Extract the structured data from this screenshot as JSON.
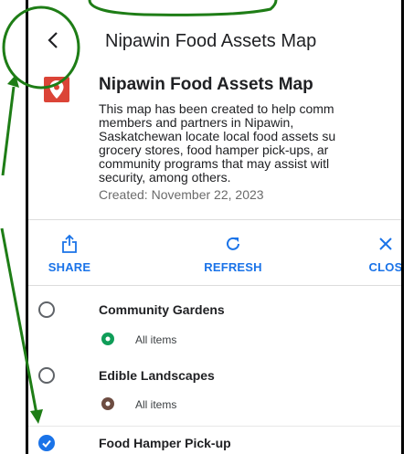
{
  "header": {
    "back_icon": "chevron-left-icon",
    "title": "Nipawin Food Assets Map"
  },
  "map_info": {
    "icon": "map-pin-icon",
    "icon_color": "#db4437",
    "title": "Nipawin Food Assets Map",
    "description": "This map has been created to help comm\nmembers and partners in Nipawin,\nSaskatchewan locate local food assets su\ngrocery stores, food hamper pick-ups, ar\ncommunity programs that may assist witl\nsecurity, among others.",
    "created": "Created: November 22, 2023"
  },
  "actions": {
    "share": {
      "label": "SHARE",
      "icon": "share-icon"
    },
    "refresh": {
      "label": "REFRESH",
      "icon": "refresh-icon"
    },
    "close": {
      "label": "CLOS",
      "icon": "close-icon"
    }
  },
  "layers": [
    {
      "name": "Community Gardens",
      "checked": false,
      "sub_label": "All items",
      "sub_color": "#0f9d58"
    },
    {
      "name": "Edible Landscapes",
      "checked": false,
      "sub_label": "All items",
      "sub_color": "#6d4c41"
    },
    {
      "name": "Food Hamper Pick-up",
      "checked": true
    }
  ],
  "colors": {
    "accent": "#1a73e8",
    "annotation": "#1e7d16"
  }
}
